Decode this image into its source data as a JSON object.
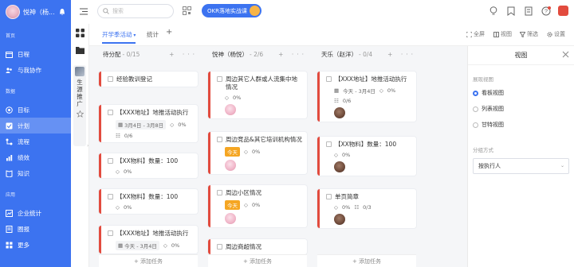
{
  "sidebar": {
    "user_name": "悦神（杨...",
    "group_home": "首页",
    "item_calendar": "日程",
    "item_collab": "与我协作",
    "group_data": "数据",
    "item_target": "目标",
    "item_plan": "计划",
    "item_process": "流程",
    "item_perf": "绩效",
    "item_knowledge": "知识",
    "group_app": "应用",
    "item_enterprise": "企业统计",
    "item_circle": "圈报",
    "item_more": "更多"
  },
  "strip": {
    "project_label": "生源推广"
  },
  "topbar": {
    "search_placeholder": "搜索",
    "okr_label": "OKR落地实战课"
  },
  "tabs": {
    "active": "开学季活动",
    "stats": "统计",
    "add": "+",
    "fullscreen": "全屏",
    "view": "视图",
    "filter": "筛选",
    "settings": "设置"
  },
  "columns": [
    {
      "title": "待分配",
      "count": "- 0/15",
      "add_task": "+ 添加任务",
      "cards": [
        {
          "title": "经验教训登记"
        },
        {
          "title": "【XXX地址】地推活动执行",
          "date": "3月4日 - 3月8日",
          "progress": "0%",
          "sub": "0/6"
        },
        {
          "title": "【XX物料】数量：100",
          "progress": "0%"
        },
        {
          "title": "【XX物料】数量：100",
          "progress": "0%"
        },
        {
          "title": "【XXX地址】地推活动执行",
          "date": "今天 - 3月4日",
          "progress": "0%"
        }
      ]
    },
    {
      "title": "悦神（杨悦）",
      "count": "- 2/6",
      "add_task": "+ 添加任务",
      "cards": [
        {
          "title": "周边其它人群或人流集中地情况",
          "progress": "0%"
        },
        {
          "title": "周边竞品&其它培训机构情况",
          "tag": "今天",
          "progress": "0%"
        },
        {
          "title": "周边小区情况",
          "tag": "今天",
          "progress": "0%"
        },
        {
          "title": "周边商超情况"
        }
      ]
    },
    {
      "title": "天乐（赵洋）",
      "count": "- 0/4",
      "add_task": "+ 添加任务",
      "cards": [
        {
          "title": "【XXX地址】地推活动执行",
          "date": "今天 - 3月4日",
          "progress": "0%",
          "sub": "0/6"
        },
        {
          "title": "【XX物料】数量：100",
          "progress": "0%"
        },
        {
          "title": "单页简章",
          "progress": "0%",
          "sub": "0/3"
        }
      ]
    }
  ],
  "panel": {
    "title": "视图",
    "section_show": "展现视图",
    "opt_kanban": "看板视图",
    "opt_list": "列表视图",
    "opt_gantt": "甘特视图",
    "section_group": "分组方式",
    "group_value": "按执行人"
  },
  "colors": {
    "primary": "#3c73f0",
    "card_edge": "#e24b3e",
    "tag_orange": "#f5a623"
  }
}
